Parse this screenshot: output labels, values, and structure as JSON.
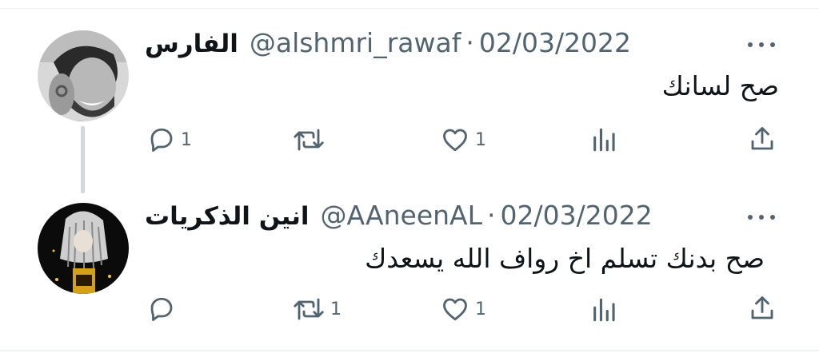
{
  "tweets": [
    {
      "display_name": "الفارس",
      "handle": "@alshmri_rawaf",
      "separator": "·",
      "date": "02/03/2022",
      "text": "صح لسانك",
      "actions": {
        "reply": "1",
        "retweet": "",
        "like": "1"
      },
      "avatar": "avatar-photo-man"
    },
    {
      "display_name": "انين الذكريات",
      "handle": "@AAneenAL",
      "separator": "·",
      "date": "02/03/2022",
      "text": "صح بدنك تسلم اخ رواف الله يسعدك",
      "actions": {
        "reply": "",
        "retweet": "1",
        "like": "1"
      },
      "avatar": "avatar-illustration"
    }
  ],
  "icons": [
    "reply-icon",
    "retweet-icon",
    "like-icon",
    "views-icon",
    "share-icon",
    "more-icon"
  ],
  "colors": {
    "text": "#0f1419",
    "secondary": "#536471",
    "divider": "#eff3f4",
    "thread_line": "#cfd9de"
  }
}
